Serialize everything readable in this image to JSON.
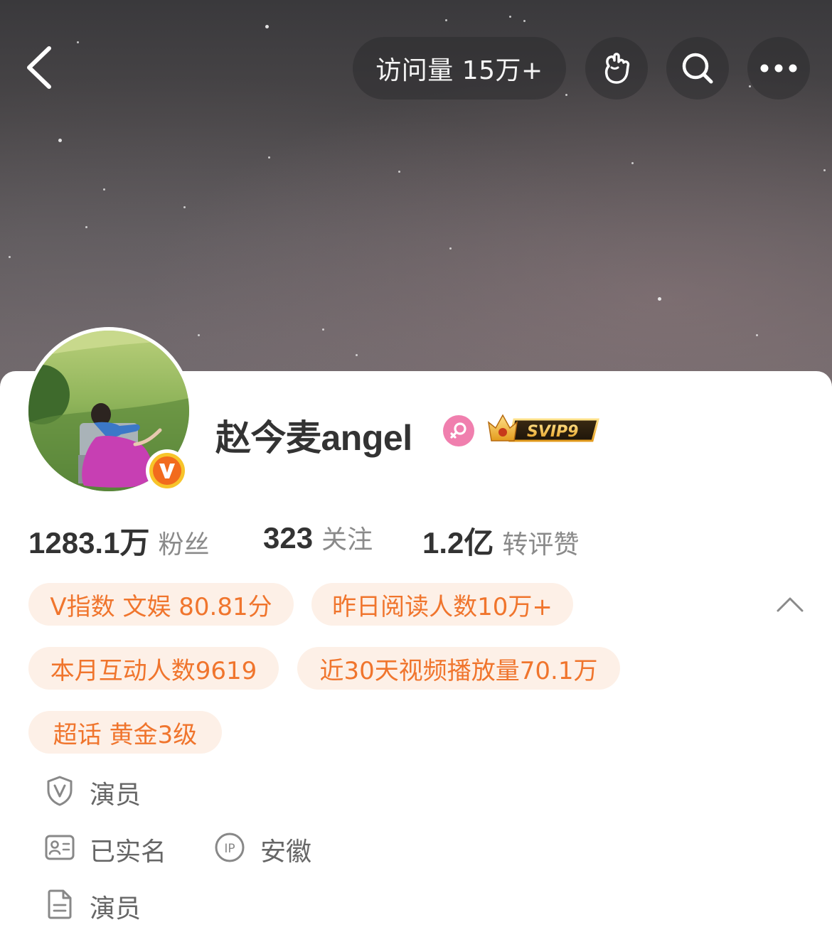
{
  "header": {
    "visits_label": "访问量 15万+"
  },
  "profile": {
    "username": "赵今麦angel",
    "svip_label": "SVIP9",
    "verified_badge_letter": "V",
    "stats": [
      {
        "value": "1283.1万",
        "label": "粉丝"
      },
      {
        "value": "323",
        "label": "关注"
      },
      {
        "value": "1.2亿",
        "label": "转评赞"
      }
    ],
    "tags": {
      "vindex": "V指数 文娱 80.81分",
      "reads": "昨日阅读人数10万+",
      "monthly": "本月互动人数9619",
      "video": "近30天视频播放量70.1万",
      "supertopic": "超话 黄金3级"
    },
    "info": {
      "role": "演员",
      "realname": "已实名",
      "ip_location": "安徽",
      "description": "演员"
    }
  },
  "colors": {
    "tag_bg": "#fdf0e7",
    "tag_text": "#f0752d",
    "gender_pink": "#f07fae",
    "verified_orange": "#f7931e"
  },
  "icons": [
    "back-icon",
    "poke-icon",
    "search-icon",
    "more-icon",
    "gender-female-icon",
    "svip-crown-icon",
    "chevron-up-icon",
    "shield-v-icon",
    "id-card-icon",
    "ip-icon",
    "document-icon"
  ]
}
